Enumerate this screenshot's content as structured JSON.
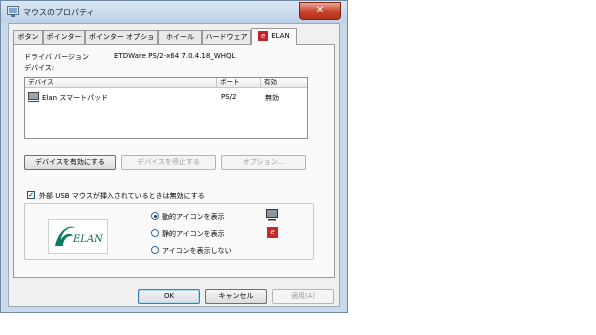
{
  "window": {
    "title": "マウスのプロパティ",
    "close_glyph": "✕"
  },
  "tabs": [
    {
      "label": "ボタン"
    },
    {
      "label": "ポインター"
    },
    {
      "label": "ポインター オプション"
    },
    {
      "label": "ホイール"
    },
    {
      "label": "ハードウェア"
    },
    {
      "label": "ELAN",
      "icon": "elan-logo-icon",
      "active": true
    }
  ],
  "elan_panel": {
    "driver_label": "ドライバ バージョン",
    "driver_value": "ETDWare PS/2-x64 7.0.4.18_WHQL",
    "devices_label": "デバイス:",
    "columns": [
      "デバイス",
      "ポート",
      "有効"
    ],
    "rows": [
      {
        "device": "Elan スマートパッド",
        "port": "PS/2",
        "enabled": "無効",
        "icon": "touchpad-icon"
      }
    ],
    "enable_button": "デバイスを有効にする",
    "disable_button": "デバイスを停止する",
    "options_button": "オプション...",
    "usb_checkbox_label": "外部 USB マウスが挿入されているときは無効にする",
    "usb_checkbox_checked": true,
    "logo_text": "ELAN",
    "logo_colors": {
      "green": "#0f7a64",
      "text": "#0f6b57"
    },
    "radio_options": [
      {
        "label": "動的アイコンを表示",
        "selected": true,
        "icon": "touchpad-monitor-icon"
      },
      {
        "label": "静的アイコンを表示",
        "selected": false,
        "icon": "elan-logo-icon"
      },
      {
        "label": "アイコンを表示しない",
        "selected": false
      }
    ]
  },
  "footer": {
    "ok": "OK",
    "cancel": "キャンセル",
    "apply": "適用(A)"
  },
  "colors": {
    "frame": "#c9d9ea",
    "close": "#c7402a",
    "elan_red": "#c2222a"
  }
}
